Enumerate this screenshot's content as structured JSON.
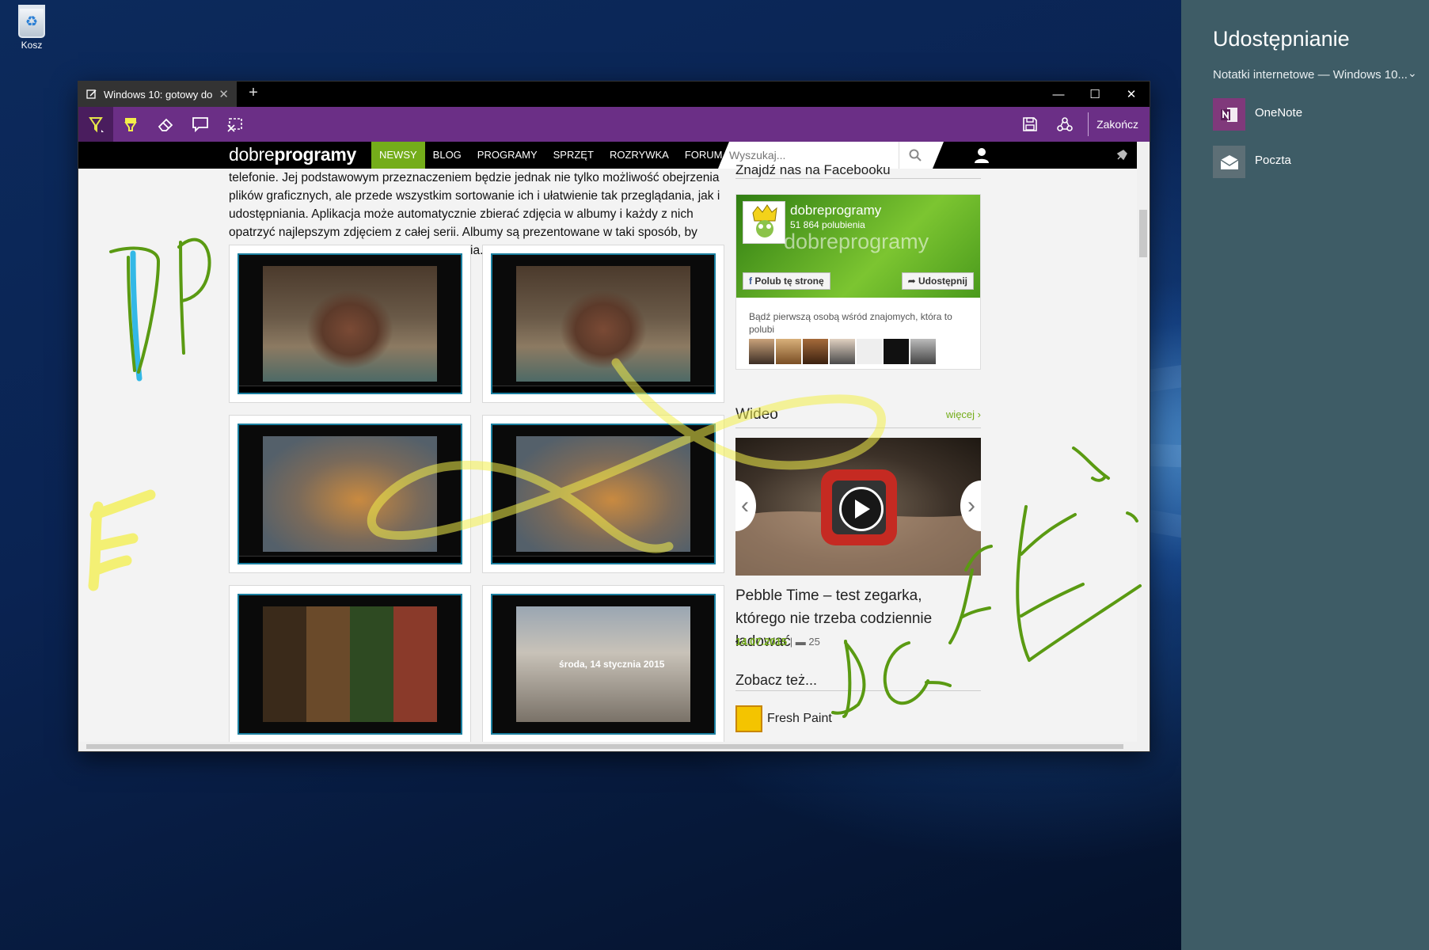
{
  "desktop": {
    "recycle_bin_label": "Kosz"
  },
  "browser": {
    "tab_title": "Windows 10: gotowy do",
    "new_tab_symbol": "+",
    "window_controls": {
      "minimize": "—",
      "maximize": "☐",
      "close": "✕"
    },
    "ink_toolbar": {
      "done_label": "Zakończ"
    }
  },
  "site": {
    "logo_regular": "dobre",
    "logo_bold": "programy",
    "nav": [
      "NEWSY",
      "BLOG",
      "PROGRAMY",
      "SPRZĘT",
      "ROZRYWKA",
      "FORUM"
    ],
    "active_nav": "NEWSY",
    "search_placeholder": "Wyszukaj..."
  },
  "article": {
    "text": "telefonie. Jej podstawowym przeznaczeniem będzie jednak nie tylko możliwość obejrzenia plików graficznych, ale przede wszystkim sortowanie ich i ułatwienie tak przeglądania, jak i udostępniania. Aplikacja może automatycznie zbierać zdjęcia w albumy i każdy z nich opatrzyć najlepszym zdjęciem z całej serii. Albumy są prezentowane w taki sposób, by pokazać najlepsze ujęcia z całego wydarzenia.",
    "screenshot_caption": "środa, 14 stycznia 2015"
  },
  "sidebar": {
    "facebook": {
      "heading": "Znajdź nas na Facebooku",
      "page_name": "dobreprogramy",
      "likes": "51 864 polubienia",
      "watermark": "dobreprogramy",
      "like_button": "Polub tę stronę",
      "share_button": "Udostępnij",
      "first_friend_text": "Bądź pierwszą osobą wśród znajomych, która to polubi"
    },
    "video": {
      "heading": "Wideo",
      "more_link": "więcej ›",
      "caption": "Pebble Time – test zegarka, którego nie trzeba codziennie ładować",
      "date": "14.07.2015",
      "separator": "|",
      "comments": "25"
    },
    "see_also": {
      "heading": "Zobacz też...",
      "item": "Fresh Paint"
    }
  },
  "ink_annotations": {
    "initials": "DP",
    "letter": "F",
    "word": "EDGE"
  },
  "share_pane": {
    "title": "Udostępnianie",
    "source": "Notatki internetowe — Windows 10...",
    "apps": [
      "OneNote",
      "Poczta"
    ]
  },
  "colors": {
    "ink_toolbar": "#6b2f86",
    "accent_green": "#74ad1a",
    "share_pane": "#3e5c66",
    "pen_ink_green": "#5a9a12",
    "highlighter_yellow": "#f3ef4a",
    "blue_ink": "#33b8e6"
  },
  "icons": {
    "toolbar": [
      "pen-icon",
      "highlighter-icon",
      "eraser-icon",
      "comment-icon",
      "clip-icon",
      "save-icon",
      "share-icon"
    ],
    "apps": [
      "onenote-icon",
      "mail-icon"
    ]
  }
}
